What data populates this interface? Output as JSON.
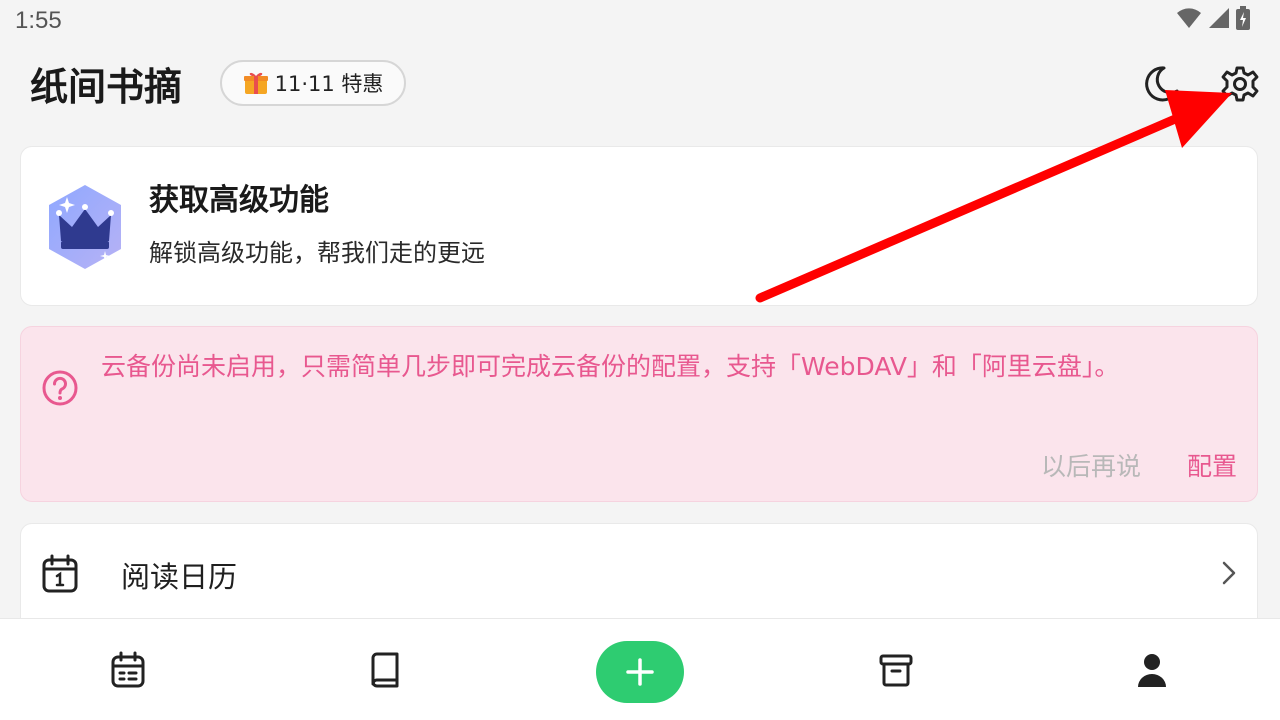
{
  "status_bar": {
    "time": "1:55",
    "icons": [
      "wifi-icon",
      "signal-icon",
      "battery-icon"
    ]
  },
  "header": {
    "title": "纸间书摘",
    "promo_label": "11·11 特惠",
    "promo_icon": "gift-icon",
    "night_mode_icon": "moon-icon",
    "settings_icon": "gear-icon"
  },
  "premium_card": {
    "title": "获取高级功能",
    "subtitle": "解锁高级功能，帮我们走的更远",
    "icon": "crown-badge-icon"
  },
  "backup_card": {
    "message": "云备份尚未启用，只需简单几步即可完成云备份的配置，支持「WebDAV」和「阿里云盘」。",
    "later_label": "以后再说",
    "config_label": "配置",
    "icon": "question-circle-icon"
  },
  "calendar_row": {
    "label": "阅读日历",
    "icon": "calendar-icon"
  },
  "bottom_nav": {
    "items": [
      "calendar-list-icon",
      "book-icon",
      "plus-icon",
      "archive-icon",
      "person-icon"
    ]
  },
  "annotation": {
    "arrow_color": "#ff0000",
    "points_to": "gear-icon"
  },
  "colors": {
    "accent_pink": "#e8588f",
    "backup_bg": "#fbe4ec",
    "fab_green": "#2ecc71",
    "page_bg": "#f4f4f4"
  }
}
